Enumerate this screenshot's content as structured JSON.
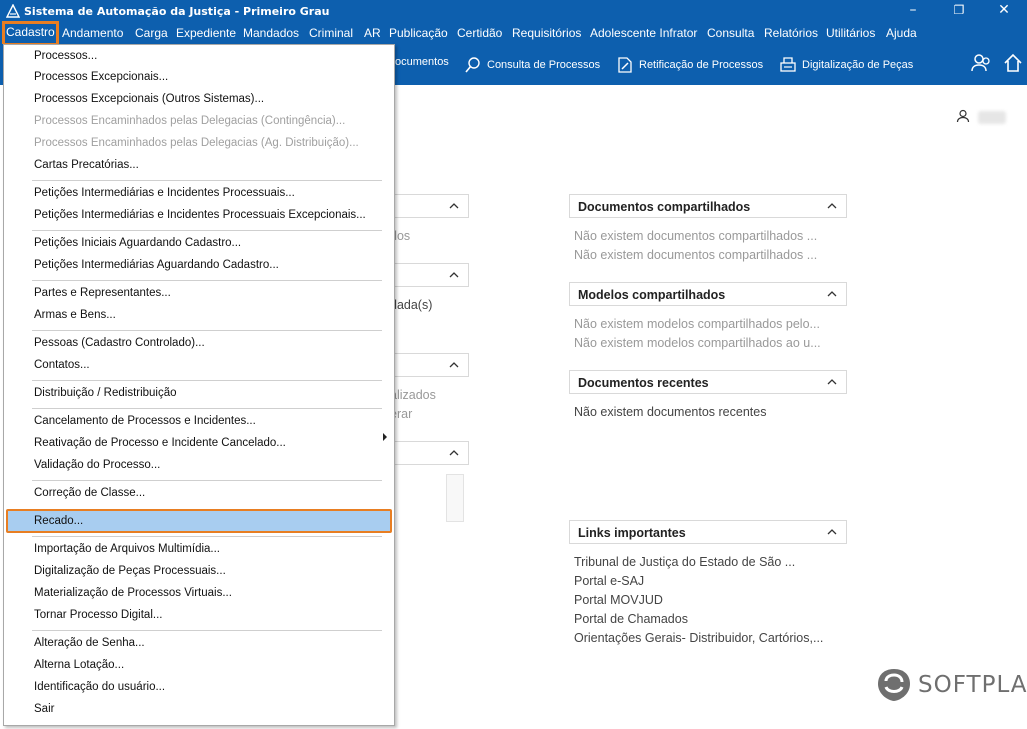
{
  "window": {
    "title": "Sistema de Automação da Justiça - Primeiro Grau",
    "minimize": "–",
    "restore": "❐",
    "close": "✕"
  },
  "menubar": [
    "Cadastro",
    "Andamento",
    "Carga",
    "Expediente",
    "Mandados",
    "Criminal",
    "AR",
    "Publicação",
    "Certidão",
    "Requisitórios",
    "Adolescente Infrator",
    "Consulta",
    "Relatórios",
    "Utilitários",
    "Ajuda"
  ],
  "toolbar": {
    "partial": "ocumentos",
    "consulta": "Consulta de Processos",
    "retificacao": "Retificação de Processos",
    "digitalizacao": "Digitalização de Peças"
  },
  "dropdown": [
    {
      "label": "Processos...",
      "enabled": true
    },
    {
      "label": "Processos Excepcionais...",
      "enabled": true
    },
    {
      "label": "Processos Excepcionais (Outros Sistemas)...",
      "enabled": true
    },
    {
      "label": "Processos Encaminhados pelas Delegacias (Contingência)...",
      "enabled": false
    },
    {
      "label": "Processos Encaminhados pelas Delegacias (Ag. Distribuição)...",
      "enabled": false
    },
    {
      "label": "Cartas Precatórias...",
      "enabled": true
    },
    {
      "label": "Petições Intermediárias e Incidentes Processuais...",
      "enabled": true
    },
    {
      "label": "Petições Intermediárias e Incidentes Processuais Excepcionais...",
      "enabled": true
    },
    {
      "label": "Petições Iniciais Aguardando Cadastro...",
      "enabled": true
    },
    {
      "label": "Petições Intermediárias Aguardando Cadastro...",
      "enabled": true
    },
    {
      "label": "Partes e Representantes...",
      "enabled": true
    },
    {
      "label": "Armas e Bens...",
      "enabled": true
    },
    {
      "label": "Pessoas (Cadastro Controlado)...",
      "enabled": true
    },
    {
      "label": "Contatos...",
      "enabled": true
    },
    {
      "label": "Distribuição / Redistribuição",
      "enabled": true
    },
    {
      "label": "Cancelamento de Processos e Incidentes...",
      "enabled": true
    },
    {
      "label": "Reativação de Processo e Incidente Cancelado...",
      "enabled": true
    },
    {
      "label": "Validação do Processo...",
      "enabled": true
    },
    {
      "label": "Correção de Classe...",
      "enabled": true
    },
    {
      "label": "Recado...",
      "enabled": true,
      "selected": true
    },
    {
      "label": "Importação de Arquivos Multimídia...",
      "enabled": true
    },
    {
      "label": "Digitalização de Peças Processuais...",
      "enabled": true
    },
    {
      "label": "Materialização de Processos Virtuais...",
      "enabled": true
    },
    {
      "label": "Tornar Processo Digital...",
      "enabled": true
    },
    {
      "label": "Alteração de Senha...",
      "enabled": true
    },
    {
      "label": "Alterna Lotação...",
      "enabled": true
    },
    {
      "label": "Identificação do usuário...",
      "enabled": true
    },
    {
      "label": "Sair",
      "enabled": true
    }
  ],
  "left_fragments": {
    "a": "dos",
    "b": "dada(s)",
    "c": "alizados",
    "d": "erar"
  },
  "panels": {
    "docs_shared": {
      "title": "Documentos compartilhados",
      "lines": [
        "Não existem documentos compartilhados ...",
        "Não existem documentos compartilhados ..."
      ]
    },
    "models_shared": {
      "title": "Modelos compartilhados",
      "lines": [
        "Não existem modelos compartilhados pelo...",
        "Não existem modelos compartilhados ao u..."
      ]
    },
    "docs_recent": {
      "title": "Documentos recentes",
      "lines": [
        "Não existem documentos recentes"
      ]
    },
    "links": {
      "title": "Links importantes",
      "lines": [
        "Tribunal de Justiça do Estado de São ...",
        "Portal e-SAJ",
        "Portal MOVJUD",
        "Portal de Chamados",
        "Orientações Gerais- Distribuidor, Cartórios,..."
      ]
    }
  },
  "brand": "SOFTPLAN",
  "colors": {
    "accent": "#0d5fae",
    "highlight": "#a8cdf0",
    "focus_border": "#e87e22"
  }
}
